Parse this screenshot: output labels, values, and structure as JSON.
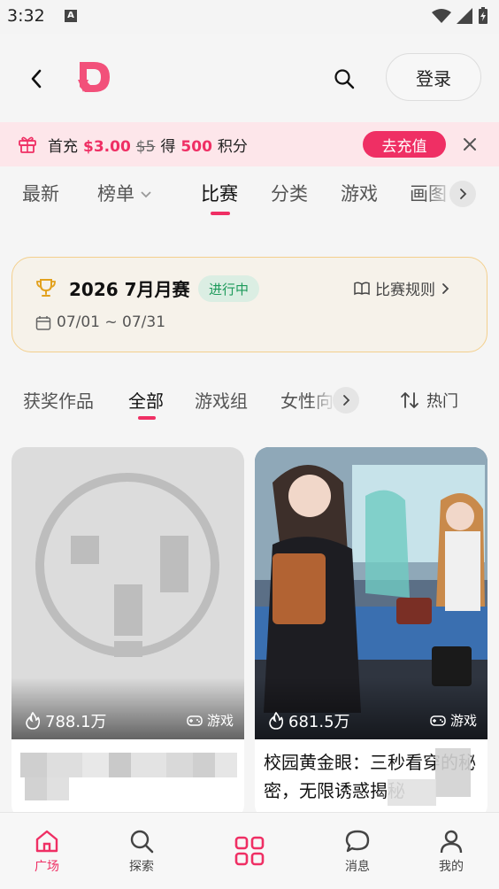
{
  "status_bar": {
    "time": "3:32",
    "a_icon": "A"
  },
  "header": {
    "login_label": "登录"
  },
  "promo": {
    "prefix": "首充",
    "price": "$3.00",
    "original_price": "$5",
    "get": "得",
    "points_value": "500",
    "points_unit": "积分",
    "cta": "去充值"
  },
  "main_tabs": [
    "最新",
    "榜单",
    "比赛",
    "分类",
    "游戏",
    "画图"
  ],
  "main_tab_active": "比赛",
  "contest": {
    "title": "2026 7月月赛",
    "status": "进行中",
    "rules": "比赛规则",
    "dates": "07/01 ~ 07/31"
  },
  "sub_tabs": [
    "获奖作品",
    "全部",
    "游戏组",
    "女性向"
  ],
  "sub_tab_active": "全部",
  "sort_label": "热门",
  "cards": [
    {
      "views": "788.1万",
      "type": "游戏",
      "title": ""
    },
    {
      "views": "681.5万",
      "type": "游戏",
      "title": "校园黄金眼：三秒看穿的秘密，无限诱惑揭秘"
    }
  ],
  "bottom_nav": [
    {
      "label": "广场",
      "icon": "home-icon",
      "active": true
    },
    {
      "label": "探索",
      "icon": "search-icon",
      "active": false
    },
    {
      "label": "",
      "icon": "grid-icon",
      "active": false
    },
    {
      "label": "消息",
      "icon": "message-icon",
      "active": false
    },
    {
      "label": "我的",
      "icon": "user-icon",
      "active": false
    }
  ],
  "colors": {
    "accent": "#ef2f64",
    "promo_bg": "#fde6ea",
    "contest_border": "#f3cf8d",
    "status_green": "#1d9a5b"
  }
}
